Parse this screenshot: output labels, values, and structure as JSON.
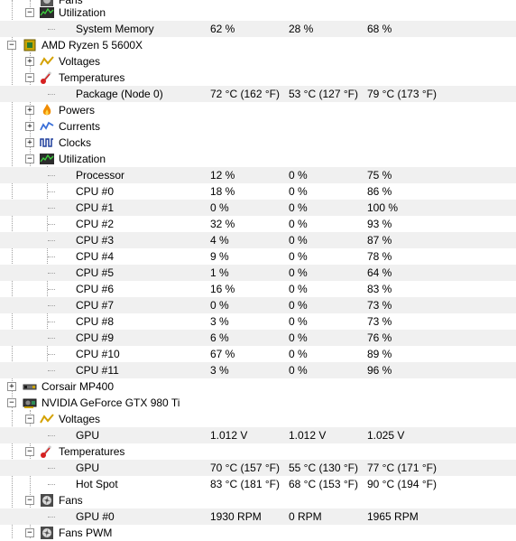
{
  "tree": {
    "top_partial_label": "Fans",
    "memory_utilization": {
      "label": "Utilization"
    },
    "system_memory": {
      "label": "System Memory",
      "value": "62 %",
      "min": "28 %",
      "max": "68 %"
    },
    "cpu": {
      "name": "AMD Ryzen 5 5600X",
      "voltages": "Voltages",
      "temperatures": "Temperatures",
      "package": {
        "label": "Package (Node 0)",
        "value": "72 °C  (162 °F)",
        "min": "53 °C  (127 °F)",
        "max": "79 °C  (173 °F)"
      },
      "powers": "Powers",
      "currents": "Currents",
      "clocks": "Clocks",
      "utilization": "Utilization",
      "util_rows": [
        {
          "label": "Processor",
          "value": "12 %",
          "min": "0 %",
          "max": "75 %"
        },
        {
          "label": "CPU #0",
          "value": "18 %",
          "min": "0 %",
          "max": "86 %"
        },
        {
          "label": "CPU #1",
          "value": "0 %",
          "min": "0 %",
          "max": "100 %"
        },
        {
          "label": "CPU #2",
          "value": "32 %",
          "min": "0 %",
          "max": "93 %"
        },
        {
          "label": "CPU #3",
          "value": "4 %",
          "min": "0 %",
          "max": "87 %"
        },
        {
          "label": "CPU #4",
          "value": "9 %",
          "min": "0 %",
          "max": "78 %"
        },
        {
          "label": "CPU #5",
          "value": "1 %",
          "min": "0 %",
          "max": "64 %"
        },
        {
          "label": "CPU #6",
          "value": "16 %",
          "min": "0 %",
          "max": "83 %"
        },
        {
          "label": "CPU #7",
          "value": "0 %",
          "min": "0 %",
          "max": "73 %"
        },
        {
          "label": "CPU #8",
          "value": "3 %",
          "min": "0 %",
          "max": "73 %"
        },
        {
          "label": "CPU #9",
          "value": "6 %",
          "min": "0 %",
          "max": "76 %"
        },
        {
          "label": "CPU #10",
          "value": "67 %",
          "min": "0 %",
          "max": "89 %"
        },
        {
          "label": "CPU #11",
          "value": "3 %",
          "min": "0 %",
          "max": "96 %"
        }
      ]
    },
    "storage": {
      "name": "Corsair MP400"
    },
    "gpu": {
      "name": "NVIDIA GeForce GTX 980 Ti",
      "voltages": "Voltages",
      "voltage_gpu": {
        "label": "GPU",
        "value": "1.012 V",
        "min": "1.012 V",
        "max": "1.025 V"
      },
      "temperatures": "Temperatures",
      "temp_gpu": {
        "label": "GPU",
        "value": "70 °C  (157 °F)",
        "min": "55 °C  (130 °F)",
        "max": "77 °C  (171 °F)"
      },
      "temp_hotspot": {
        "label": "Hot Spot",
        "value": "83 °C  (181 °F)",
        "min": "68 °C  (153 °F)",
        "max": "90 °C  (194 °F)"
      },
      "fans": "Fans",
      "fan0": {
        "label": "GPU #0",
        "value": "1930 RPM",
        "min": "0 RPM",
        "max": "1965 RPM"
      },
      "fans_pwm": "Fans PWM"
    }
  },
  "glyphs": {
    "expanded": "−",
    "collapsed": "+"
  },
  "colors": {
    "shade": "#f0f0f0",
    "tree_line": "#a0a0a0"
  }
}
